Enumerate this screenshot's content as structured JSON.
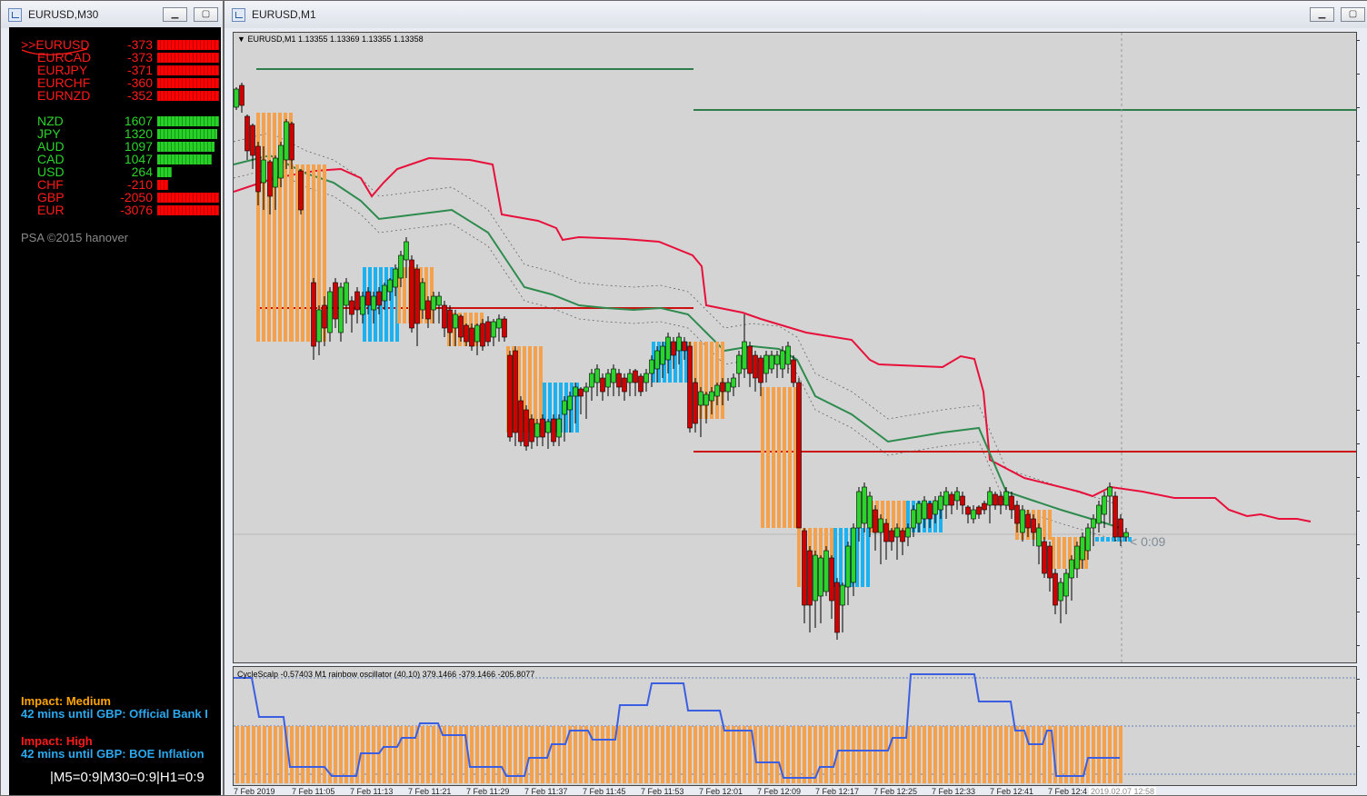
{
  "left_window": {
    "title": "EURUSD,M30",
    "pairs": [
      {
        "name": ">>EURUSD",
        "value": "-373",
        "color": "#ff1a1a",
        "strength": 1.0
      },
      {
        "name": "EURCAD",
        "value": "-373",
        "color": "#ff1a1a",
        "strength": 1.0
      },
      {
        "name": "EURJPY",
        "value": "-371",
        "color": "#ff1a1a",
        "strength": 1.0
      },
      {
        "name": "EURCHF",
        "value": "-360",
        "color": "#ff1a1a",
        "strength": 1.0
      },
      {
        "name": "EURNZD",
        "value": "-352",
        "color": "#ff1a1a",
        "strength": 1.0
      }
    ],
    "currencies": [
      {
        "name": "NZD",
        "value": "1607",
        "color": "#2bd42b",
        "strength": 1.0
      },
      {
        "name": "JPY",
        "value": "1320",
        "color": "#2bd42b",
        "strength": 0.97
      },
      {
        "name": "AUD",
        "value": "1097",
        "color": "#2bd42b",
        "strength": 0.93
      },
      {
        "name": "CAD",
        "value": "1047",
        "color": "#2bd42b",
        "strength": 0.88
      },
      {
        "name": "USD",
        "value": "264",
        "color": "#2bd42b",
        "strength": 0.23
      },
      {
        "name": "CHF",
        "value": "-210",
        "color": "#ff1a1a",
        "strength": 0.18
      },
      {
        "name": "GBP",
        "value": "-2050",
        "color": "#ff1a1a",
        "strength": 1.0
      },
      {
        "name": "EUR",
        "value": "-3076",
        "color": "#ff1a1a",
        "strength": 1.0
      }
    ],
    "copyright": "PSA ©2015 hanover",
    "news": [
      {
        "impact": "Impact: Medium",
        "impact_color": "#ffa500",
        "event": "42 mins until GBP: Official Bank I"
      },
      {
        "impact": "Impact: High",
        "impact_color": "#ff1a1a",
        "event": "42 mins until GBP: BOE Inflation"
      }
    ],
    "timers": "|M5=0:9|M30=0:9|H1=0:9"
  },
  "main_window": {
    "title": "EURUSD,M1",
    "symbol_line": "EURUSD,M1  1.13355 1.13369 1.13355 1.13358",
    "countdown": "< 0:09",
    "indicator_label": "CycleScalp -0.57403  M1 rainbow oscillator (40,10) 379.1466 -379.1466 -205.8077",
    "time_labels": [
      "7 Feb 2019",
      "7 Feb 11:05",
      "7 Feb 11:13",
      "7 Feb 11:21",
      "7 Feb 11:29",
      "7 Feb 11:37",
      "7 Feb 11:45",
      "7 Feb 11:53",
      "7 Feb 12:01",
      "7 Feb 12:09",
      "7 Feb 12:17",
      "7 Feb 12:25",
      "7 Feb 12:33",
      "7 Feb 12:41",
      "7 Feb 12:4"
    ],
    "time_stamp_box": "2019.02.07 12:58",
    "colors": {
      "bull": "#2bd42b",
      "bear": "#d00000",
      "orange": "#f5a04a",
      "blue": "#1ab2f0",
      "upper_band": "#e8103a",
      "mid_band": "#2e8b4e",
      "level_green": "#2e7d4a",
      "level_red": "#cc1111",
      "osc_line": "#3b5fe0"
    }
  }
}
